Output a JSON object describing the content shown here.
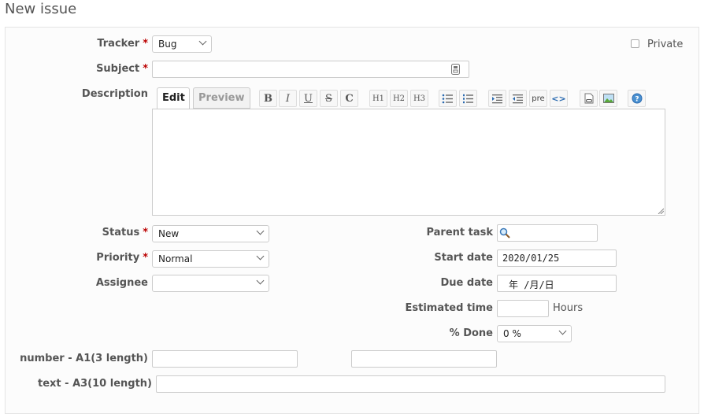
{
  "page": {
    "title": "New issue"
  },
  "form": {
    "tracker": {
      "label": "Tracker",
      "required": "*",
      "value": "Bug"
    },
    "private": {
      "label": "Private"
    },
    "subject": {
      "label": "Subject",
      "required": "*",
      "value": ""
    },
    "description": {
      "label": "Description"
    },
    "status": {
      "label": "Status",
      "required": "*",
      "value": "New"
    },
    "priority": {
      "label": "Priority",
      "required": "*",
      "value": "Normal"
    },
    "assignee": {
      "label": "Assignee",
      "value": ""
    },
    "parent_task": {
      "label": "Parent task",
      "value": ""
    },
    "start_date": {
      "label": "Start date",
      "value": "2020/01/25"
    },
    "due_date": {
      "label": "Due date",
      "value": "年 /月/日"
    },
    "estimated_time": {
      "label": "Estimated time",
      "value": "",
      "unit": "Hours"
    },
    "done": {
      "label": "% Done",
      "value": "0 %"
    },
    "number_a1": {
      "label": "number - A1(3 length)",
      "value": ""
    },
    "text_a3": {
      "label": "text - A3(10 length)",
      "value": ""
    }
  },
  "editor": {
    "tabs": {
      "edit": "Edit",
      "preview": "Preview"
    },
    "toolbar": {
      "bold": "B",
      "italic": "I",
      "underline": "U",
      "strike": "S",
      "code": "C",
      "h1": "H1",
      "h2": "H2",
      "h3": "H3",
      "pre": "pre",
      "code_highlight": "<>",
      "help": "?"
    }
  }
}
